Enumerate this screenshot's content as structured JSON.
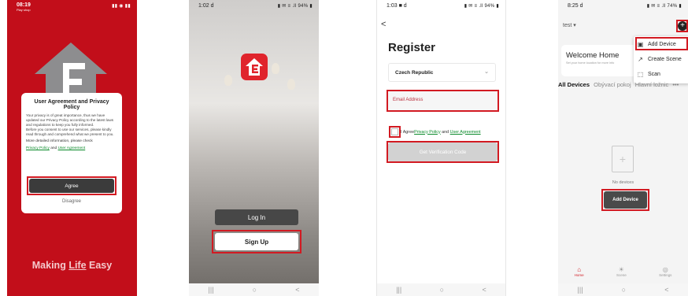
{
  "phone1": {
    "status_time": "08:19",
    "status_sub": "Play shop",
    "status_icons": "▮▮ ◉ ▮▮",
    "dialog_title": "User Agreement and Privacy Policy",
    "dialog_body": "Your privacy is of great importance, thus we have updated our Privacy Policy according to the latest laws and regulations to keep you fully informed.\nBefore you consent to use our services, please kindly read through and comprehend what we present to you.",
    "dialog_more": "More detailed information, please check",
    "privacy_link": "Privacy Policy",
    "and_word": "and",
    "agreement_link": "User Agreement",
    "agree_label": "Agree",
    "disagree_label": "Disagree",
    "slogan_pre": "Making ",
    "slogan_life": "Life",
    "slogan_post": " Easy",
    "colors": {
      "brand_red": "#c20e1a",
      "highlight": "#d21a22"
    }
  },
  "phone2": {
    "status_time": "1:02 d",
    "status_icons": "▮ ✉ ≡ .ll 94% ▮",
    "login_label": "Log In",
    "signup_label": "Sign Up",
    "nav_icons": [
      "|||",
      "○",
      "<"
    ]
  },
  "phone3": {
    "status_time": "1:03 ■ d",
    "status_icons": "▮ ✉ ≡ .ll 94% ▮",
    "back_icon": "<",
    "title": "Register",
    "country": "Czech Republic",
    "email_placeholder": "Email Address",
    "agree_prefix": "I Agree",
    "privacy_link": "Privacy Policy",
    "and_word": "and",
    "agreement_link": "User Agreement",
    "get_code_label": "Get Verification Code",
    "nav_icons": [
      "|||",
      "○",
      "<"
    ]
  },
  "phone4": {
    "status_time": "8:25 d",
    "status_icons": "▮ ✉ ≡ .ll 74% ▮",
    "home_name": "test ▾",
    "welcome_title": "Welcome Home",
    "welcome_sub": "Set your home location for more info",
    "menu": [
      {
        "icon": "▣",
        "label": "Add Device"
      },
      {
        "icon": "↗",
        "label": "Create Scene"
      },
      {
        "icon": "⬚",
        "label": "Scan"
      }
    ],
    "tabs": [
      "All Devices",
      "Obývací pokoj",
      "Hlavní ložnic",
      "•••"
    ],
    "no_devices": "No devices",
    "add_device_label": "Add Device",
    "bottom_nav": [
      {
        "icon": "⌂",
        "label": "Home"
      },
      {
        "icon": "☀",
        "label": "Scene"
      },
      {
        "icon": "◎",
        "label": "Settings"
      }
    ],
    "nav_icons": [
      "|||",
      "○",
      "<"
    ]
  }
}
